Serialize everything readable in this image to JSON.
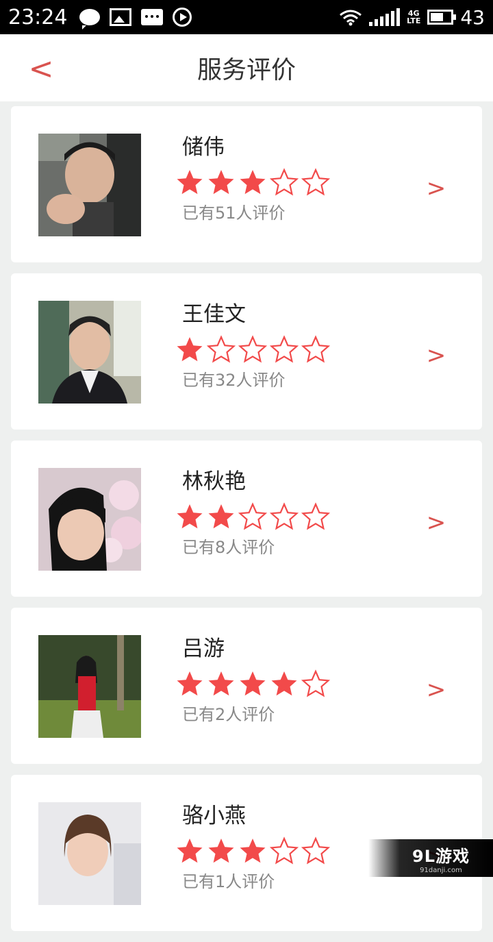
{
  "status_bar": {
    "time": "23:24",
    "network": "4G",
    "network_sub": "LTE",
    "battery": "43"
  },
  "header": {
    "back_label": "<",
    "title": "服务评价"
  },
  "colors": {
    "accent": "#d9534f",
    "star": "#f24a4a",
    "background": "#eef0ef"
  },
  "reviewers": [
    {
      "name": "储伟",
      "rating": 3,
      "rating_max": 5,
      "count_text": "已有51人评价",
      "avatar": "photo-man-car"
    },
    {
      "name": "王佳文",
      "rating": 1,
      "rating_max": 5,
      "count_text": "已有32人评价",
      "avatar": "photo-man-suit"
    },
    {
      "name": "林秋艳",
      "rating": 2,
      "rating_max": 5,
      "count_text": "已有8人评价",
      "avatar": "photo-woman-flowers"
    },
    {
      "name": "吕游",
      "rating": 4,
      "rating_max": 5,
      "count_text": "已有2人评价",
      "avatar": "photo-woman-garden"
    },
    {
      "name": "骆小燕",
      "rating": 3,
      "rating_max": 5,
      "count_text": "已有1人评价",
      "avatar": "photo-woman-indoor"
    }
  ],
  "chevron": ">",
  "watermark": {
    "main": "9L游戏",
    "sub": "91danji.com"
  }
}
